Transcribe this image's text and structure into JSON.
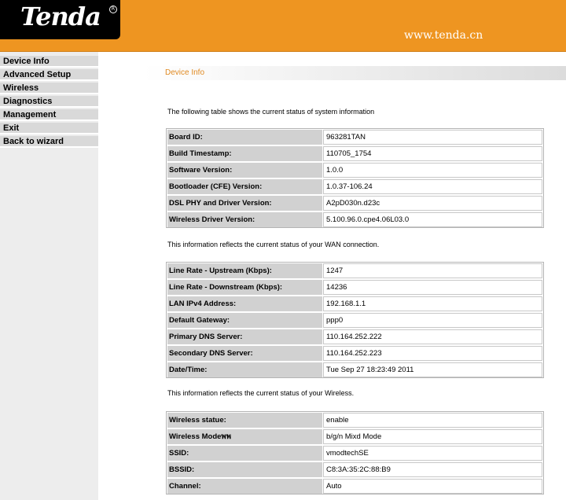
{
  "header": {
    "logo": "Tenda",
    "logo_mark": "R",
    "url": "www.tenda.cn"
  },
  "nav": {
    "items": [
      {
        "label": "Device Info"
      },
      {
        "label": "Advanced Setup"
      },
      {
        "label": "Wireless"
      },
      {
        "label": "Diagnostics"
      },
      {
        "label": "Management"
      },
      {
        "label": "Exit"
      },
      {
        "label": "Back to wizard"
      }
    ]
  },
  "page": {
    "title": "Device Info"
  },
  "system": {
    "intro": "The following table shows the current status of system information",
    "rows": [
      {
        "label": "Board ID:",
        "value": "963281TAN"
      },
      {
        "label": "Build Timestamp:",
        "value": "110705_1754"
      },
      {
        "label": "Software Version:",
        "value": "1.0.0"
      },
      {
        "label": "Bootloader (CFE) Version:",
        "value": "1.0.37-106.24"
      },
      {
        "label": "DSL PHY and Driver Version:",
        "value": "A2pD030n.d23c"
      },
      {
        "label": "Wireless Driver Version:",
        "value": "5.100.96.0.cpe4.06L03.0"
      }
    ]
  },
  "wan": {
    "intro": "This information reflects the current status of your WAN connection.",
    "rows": [
      {
        "label": "Line Rate - Upstream (Kbps):",
        "value": "1247"
      },
      {
        "label": "Line Rate - Downstream (Kbps):",
        "value": "14236"
      },
      {
        "label": "LAN IPv4 Address:",
        "value": "192.168.1.1"
      },
      {
        "label": "Default Gateway:",
        "value": "ppp0"
      },
      {
        "label": "Primary DNS Server:",
        "value": "110.164.252.222"
      },
      {
        "label": "Secondary DNS Server:",
        "value": "110.164.252.223"
      },
      {
        "label": "Date/Time:",
        "value": "Tue Sep 27 18:23:49 2011"
      }
    ]
  },
  "wireless": {
    "intro": "This information reflects the current status of your Wireless.",
    "rows": [
      {
        "label": "Wireless statue:",
        "value": "enable"
      },
      {
        "label": "Wireless Modeพพ",
        "value": "b/g/n Mixd Mode"
      },
      {
        "label": "SSID:",
        "value": "vmodtechSE"
      },
      {
        "label": "BSSID:",
        "value": "C8:3A:35:2C:88:B9"
      },
      {
        "label": "Channel:",
        "value": "Auto"
      }
    ]
  }
}
